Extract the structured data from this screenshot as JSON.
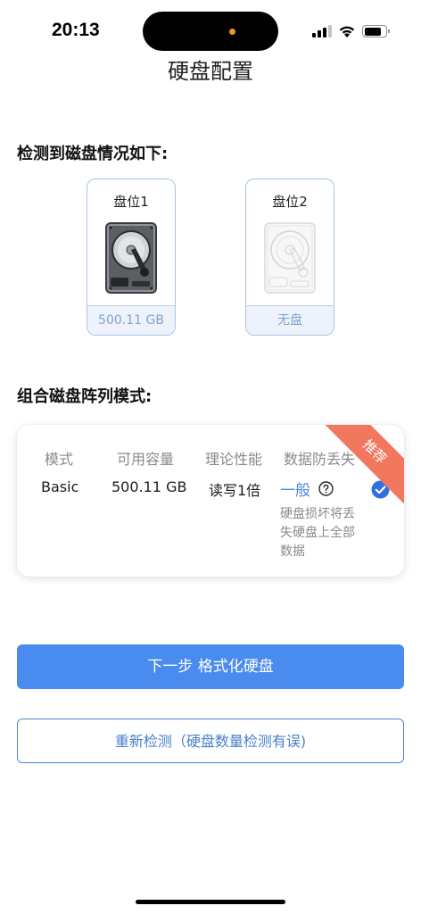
{
  "status_bar": {
    "time": "20:13",
    "icons": [
      "cellular-signal-icon",
      "wifi-icon",
      "battery-icon"
    ]
  },
  "page": {
    "title": "硬盘配置"
  },
  "detect_section": {
    "title": "检测到磁盘情况如下:",
    "slots": [
      {
        "label": "盘位1",
        "status": "500.11 GB",
        "icon": "hard-drive-icon"
      },
      {
        "label": "盘位2",
        "status": "无盘",
        "icon": "hard-drive-empty-icon"
      }
    ]
  },
  "raid_section": {
    "title": "组合磁盘阵列模式:",
    "headers": {
      "mode": "模式",
      "capacity": "可用容量",
      "performance": "理论性能",
      "protection": "数据防丢失"
    },
    "option": {
      "mode": "Basic",
      "capacity": "500.11 GB",
      "performance": "读写1倍",
      "protection_level": "一般",
      "protection_desc": "硬盘损坏将丢失硬盘上全部数据",
      "badge": "推荐",
      "selected": true
    }
  },
  "actions": {
    "next_label": "下一步 格式化硬盘",
    "redetect_label": "重新检测（硬盘数量检测有误)"
  },
  "colors": {
    "accent": "#4a8bf0",
    "badge": "#f2775f",
    "muted_text": "#8a8a8e",
    "slot_border": "#a9c4e6"
  }
}
